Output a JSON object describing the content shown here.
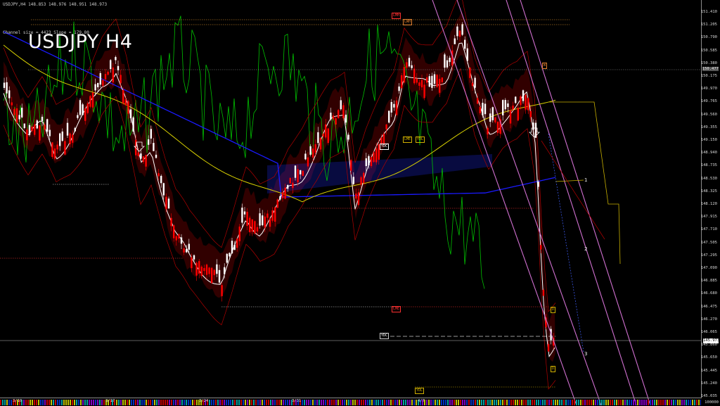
{
  "window": {
    "symbol_line": "USDJPY,H4  148.853 148.976 148.951 148.973",
    "channel_line": "Channel size = 4423  Slope = 179.80",
    "title": "USDJPY  H4"
  },
  "price_axis": {
    "ticks": [
      "151.410",
      "151.205",
      "150.790",
      "150.585",
      "150.380",
      "150.175",
      "149.970",
      "149.765",
      "149.560",
      "149.355",
      "149.150",
      "148.940",
      "148.735",
      "148.530",
      "148.325",
      "148.120",
      "147.915",
      "147.710",
      "147.505",
      "147.295",
      "147.090",
      "146.885",
      "146.680",
      "146.475",
      "146.270",
      "146.065",
      "145.860",
      "145.650",
      "145.445",
      "145.240",
      "145.035"
    ],
    "current_price": "145.973",
    "marker_label": "150.477"
  },
  "time_axis": {
    "dates": [
      "3/10",
      "3/17",
      "3/24",
      "3/31",
      "4/7"
    ],
    "bottom_label": "100000"
  },
  "levels": {
    "lwh": "LWH",
    "lmh": "LMH",
    "w": "W",
    "ydc": "YDC",
    "ydl": "YDL",
    "lme": "LME",
    "d": "D"
  },
  "channel_numbers": [
    "1",
    "2",
    "3"
  ],
  "colors": {
    "background": "#000000",
    "bull_candle": "#ffffff",
    "bear_candle": "#ff0000",
    "ichimoku_cloud": "#8b0000",
    "kumo_blue": "#1e2cff",
    "channel_lines": "#d070d0",
    "ma_yellow": "#d8d000",
    "ma_white": "#ffffff",
    "oscillator_green": "#00c000"
  }
}
